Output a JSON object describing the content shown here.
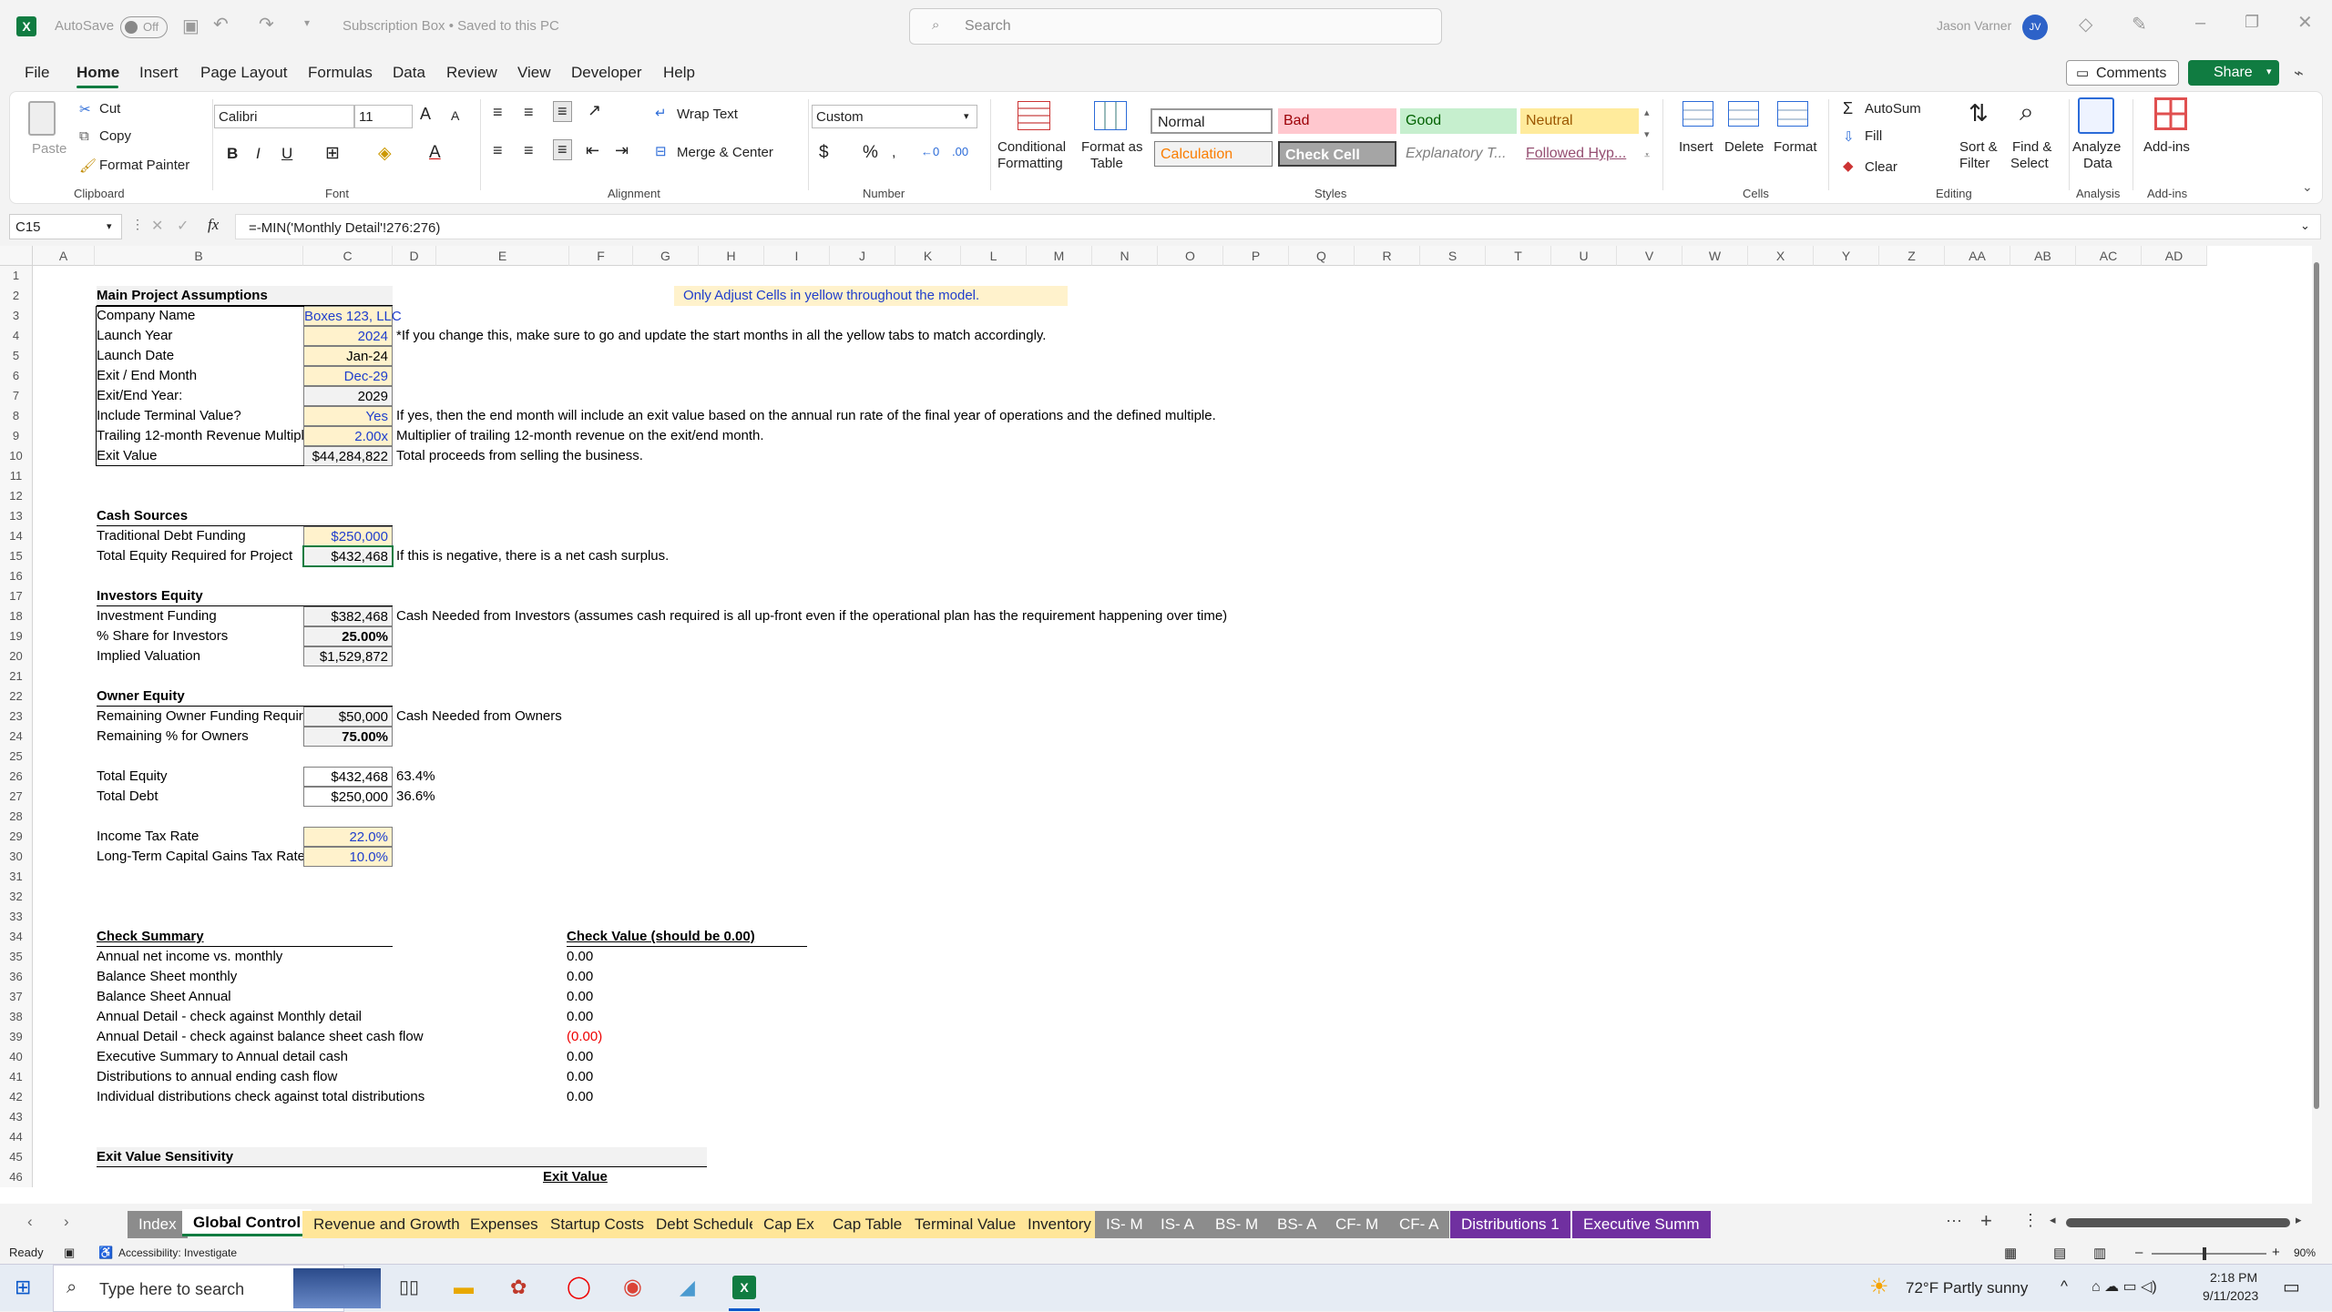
{
  "titlebar": {
    "autosave_label": "AutoSave",
    "autosave_state": "Off",
    "doc_title": "Subscription Box • Saved to this PC",
    "search_placeholder": "Search",
    "user_name": "Jason Varner",
    "user_initials": "JV"
  },
  "menu": [
    "File",
    "Home",
    "Insert",
    "Page Layout",
    "Formulas",
    "Data",
    "Review",
    "View",
    "Developer",
    "Help"
  ],
  "menu_active": "Home",
  "menu_right": {
    "comments": "Comments",
    "share": "Share"
  },
  "ribbon": {
    "clipboard": {
      "paste": "Paste",
      "cut": "Cut",
      "copy": "Copy",
      "format_painter": "Format Painter",
      "label": "Clipboard"
    },
    "font": {
      "name": "Calibri",
      "size": "11",
      "label": "Font",
      "bold": "B",
      "italic": "I",
      "underline": "U",
      "grow": "A",
      "shrink": "A"
    },
    "alignment": {
      "wrap": "Wrap Text",
      "merge": "Merge & Center",
      "label": "Alignment"
    },
    "number": {
      "format": "Custom",
      "label": "Number",
      "currency": "$",
      "percent": "%"
    },
    "styles": {
      "conditional": [
        "Conditional",
        "Formatting"
      ],
      "format_table": [
        "Format as",
        "Table"
      ],
      "normal": "Normal",
      "bad": "Bad",
      "good": "Good",
      "neutral": "Neutral",
      "calculation": "Calculation",
      "check_cell": "Check Cell",
      "explanatory": "Explanatory T...",
      "followed": "Followed Hyp...",
      "label": "Styles"
    },
    "cells": {
      "insert": "Insert",
      "delete": "Delete",
      "format": "Format",
      "label": "Cells"
    },
    "editing": {
      "autosum": "AutoSum",
      "fill": "Fill",
      "clear": "Clear",
      "sort": [
        "Sort &",
        "Filter"
      ],
      "find": [
        "Find &",
        "Select"
      ],
      "label": "Editing"
    },
    "analysis": {
      "analyze": [
        "Analyze",
        "Data"
      ],
      "label": "Analysis"
    },
    "addins": {
      "addins": "Add-ins",
      "label": "Add-ins"
    }
  },
  "formula_bar": {
    "name_box": "C15",
    "fx": "fx",
    "formula": "=-MIN('Monthly Detail'!276:276)"
  },
  "columns": [
    "A",
    "B",
    "C",
    "D",
    "E",
    "F",
    "G",
    "H",
    "I",
    "J",
    "K",
    "L",
    "M",
    "N",
    "O",
    "P",
    "Q",
    "R",
    "S",
    "T",
    "U",
    "V",
    "W",
    "X",
    "Y",
    "Z",
    "AA",
    "AB",
    "AC",
    "AD"
  ],
  "rows": [
    "1",
    "2",
    "3",
    "4",
    "5",
    "6",
    "7",
    "8",
    "9",
    "10",
    "11",
    "12",
    "13",
    "14",
    "15",
    "16",
    "17",
    "18",
    "19",
    "20",
    "21",
    "22",
    "23",
    "24",
    "25",
    "26",
    "27",
    "28",
    "29",
    "30",
    "31",
    "32",
    "33",
    "34",
    "35",
    "36",
    "37",
    "38",
    "39",
    "40",
    "41",
    "42",
    "43",
    "44",
    "45",
    "46"
  ],
  "sheet": {
    "note": "Only Adjust Cells in yellow throughout the model.",
    "main_header": "Main Project Assumptions",
    "assumptions": [
      {
        "label": "Company Name",
        "value": "Boxes 123, LLC",
        "comment": ""
      },
      {
        "label": "Launch Year",
        "value": "2024",
        "comment": "*If you change this, make sure to go and update the start months in all the yellow tabs to match accordingly."
      },
      {
        "label": "Launch Date",
        "value": "Jan-24",
        "comment": ""
      },
      {
        "label": "Exit / End Month",
        "value": "Dec-29",
        "comment": ""
      },
      {
        "label": "Exit/End Year:",
        "value": "2029",
        "comment": ""
      },
      {
        "label": "Include Terminal Value?",
        "value": "Yes",
        "comment": "If yes, then the end month will include an exit value based on the annual run rate of the final year of operations and the defined multiple."
      },
      {
        "label": "Trailing 12-month Revenue Multiple",
        "value": "2.00x",
        "comment": "Multiplier of trailing 12-month revenue on the exit/end month."
      },
      {
        "label": "Exit Value",
        "value": "$44,284,822",
        "comment": "Total proceeds from selling the business."
      }
    ],
    "cash_header": "Cash Sources",
    "cash": [
      {
        "label": "Traditional Debt Funding",
        "value": "$250,000",
        "comment": ""
      },
      {
        "label": "Total Equity Required for Project",
        "value": "$432,468",
        "comment": "If this is negative, there is a net cash surplus."
      }
    ],
    "inv_header": "Investors Equity",
    "investors": [
      {
        "label": "Investment Funding",
        "value": "$382,468",
        "comment": "Cash Needed from Investors (assumes cash required is all up-front even if the operational plan has the requirement happening over time)"
      },
      {
        "label": "% Share for Investors",
        "value": "25.00%",
        "comment": ""
      },
      {
        "label": "Implied Valuation",
        "value": "$1,529,872",
        "comment": ""
      }
    ],
    "owner_header": "Owner Equity",
    "owners": [
      {
        "label": "Remaining Owner Funding Required",
        "value": "$50,000",
        "comment": "Cash Needed from Owners"
      },
      {
        "label": "Remaining % for Owners",
        "value": "75.00%",
        "comment": ""
      }
    ],
    "totals": [
      {
        "label": "Total Equity",
        "value": "$432,468",
        "comment": "63.4%"
      },
      {
        "label": "Total Debt",
        "value": "$250,000",
        "comment": "36.6%"
      }
    ],
    "taxes": [
      {
        "label": "Income Tax Rate",
        "value": "22.0%"
      },
      {
        "label": "Long-Term Capital Gains Tax Rate",
        "value": "10.0%"
      }
    ],
    "check_header": "Check Summary",
    "check_value_header": "Check Value (should be 0.00)",
    "checks": [
      {
        "label": "Annual net income vs. monthly",
        "value": "0.00"
      },
      {
        "label": "Balance Sheet monthly",
        "value": "0.00"
      },
      {
        "label": "Balance Sheet Annual",
        "value": "0.00"
      },
      {
        "label": "Annual Detail - check against Monthly detail",
        "value": "0.00"
      },
      {
        "label": "Annual Detail - check against balance sheet cash flow",
        "value": "(0.00)"
      },
      {
        "label": "Executive Summary to Annual detail cash",
        "value": "0.00"
      },
      {
        "label": "Distributions to annual ending cash flow",
        "value": "0.00"
      },
      {
        "label": "Individual distributions check against total distributions",
        "value": "0.00"
      }
    ],
    "sens_header": "Exit Value Sensitivity",
    "sens_sub": "Exit Value"
  },
  "tabs": [
    "Index",
    "Global Control",
    "Revenue and Growth",
    "Expenses",
    "Startup Costs",
    "Debt Schedule",
    "Cap Ex",
    "Cap Table",
    "Terminal Value",
    "Inventory",
    "IS- M",
    "IS- A",
    "BS- M",
    "BS- A",
    "CF- M",
    "CF- A",
    "Distributions 1",
    "Executive Summ"
  ],
  "active_tab": "Global Control",
  "status": {
    "ready": "Ready",
    "accessibility": "Accessibility: Investigate",
    "zoom": "90%"
  },
  "taskbar": {
    "search": "Type here to search",
    "weather": "72°F  Partly sunny",
    "time": "2:18 PM",
    "date": "9/11/2023"
  }
}
